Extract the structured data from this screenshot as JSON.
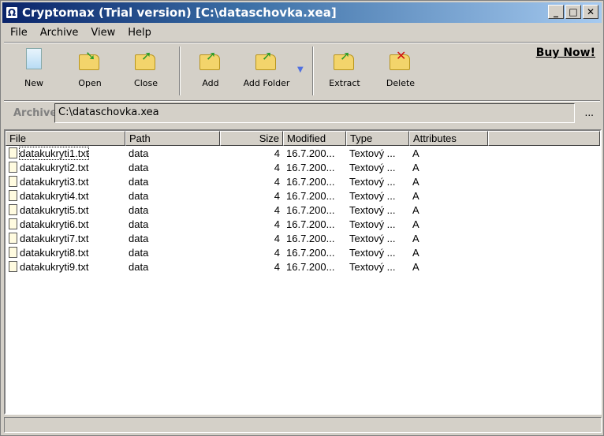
{
  "window": {
    "title": "Cryptomax (Trial version) [C:\\dataschovka.xea]"
  },
  "menu": [
    "File",
    "Archive",
    "View",
    "Help"
  ],
  "toolbar": {
    "new": "New",
    "open": "Open",
    "close": "Close",
    "add": "Add",
    "add_folder": "Add Folder",
    "extract": "Extract",
    "delete": "Delete",
    "buy": "Buy Now!"
  },
  "archive": {
    "label": "Archive",
    "path": "C:\\dataschovka.xea",
    "browse": "..."
  },
  "columns": [
    "File",
    "Path",
    "Size",
    "Modified",
    "Type",
    "Attributes"
  ],
  "rows": [
    [
      "datakukryti1.txt",
      "data",
      "4",
      "16.7.200...",
      "Textový ...",
      "A"
    ],
    [
      "datakukryti2.txt",
      "data",
      "4",
      "16.7.200...",
      "Textový ...",
      "A"
    ],
    [
      "datakukryti3.txt",
      "data",
      "4",
      "16.7.200...",
      "Textový ...",
      "A"
    ],
    [
      "datakukryti4.txt",
      "data",
      "4",
      "16.7.200...",
      "Textový ...",
      "A"
    ],
    [
      "datakukryti5.txt",
      "data",
      "4",
      "16.7.200...",
      "Textový ...",
      "A"
    ],
    [
      "datakukryti6.txt",
      "data",
      "4",
      "16.7.200...",
      "Textový ...",
      "A"
    ],
    [
      "datakukryti7.txt",
      "data",
      "4",
      "16.7.200...",
      "Textový ...",
      "A"
    ],
    [
      "datakukryti8.txt",
      "data",
      "4",
      "16.7.200...",
      "Textový ...",
      "A"
    ],
    [
      "datakukryti9.txt",
      "data",
      "4",
      "16.7.200...",
      "Textový ...",
      "A"
    ]
  ]
}
